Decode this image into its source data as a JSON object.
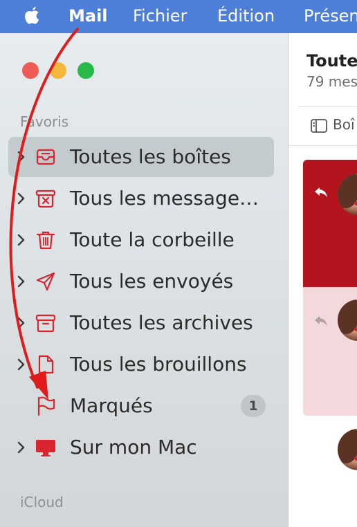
{
  "menubar": {
    "items": [
      "Mail",
      "Fichier",
      "Édition",
      "Présen"
    ]
  },
  "sidebar": {
    "favorites_title": "Favoris",
    "items": [
      {
        "label": "Toutes les boîtes",
        "icon": "tray-icon",
        "selected": true
      },
      {
        "label": "Tous les message…",
        "icon": "junk-icon"
      },
      {
        "label": "Toute la corbeille",
        "icon": "trash-icon"
      },
      {
        "label": "Tous les envoyés",
        "icon": "paperplane-icon"
      },
      {
        "label": "Toutes les archives",
        "icon": "archive-icon"
      },
      {
        "label": "Tous les brouillons",
        "icon": "document-icon"
      },
      {
        "label": "Marqués",
        "icon": "flag-icon",
        "badge": "1"
      },
      {
        "label": "Sur mon Mac",
        "icon": "desktop-icon"
      }
    ],
    "icloud_title": "iCloud"
  },
  "list": {
    "title": "Toute",
    "count": "79 mes",
    "filter_label": "Boî"
  },
  "colors": {
    "accent": "#d8252f",
    "menubar": "#4d7fd8",
    "selected_row": "#c4cbce",
    "card_primary": "#b3141e",
    "card_secondary": "#f3d9dc"
  }
}
